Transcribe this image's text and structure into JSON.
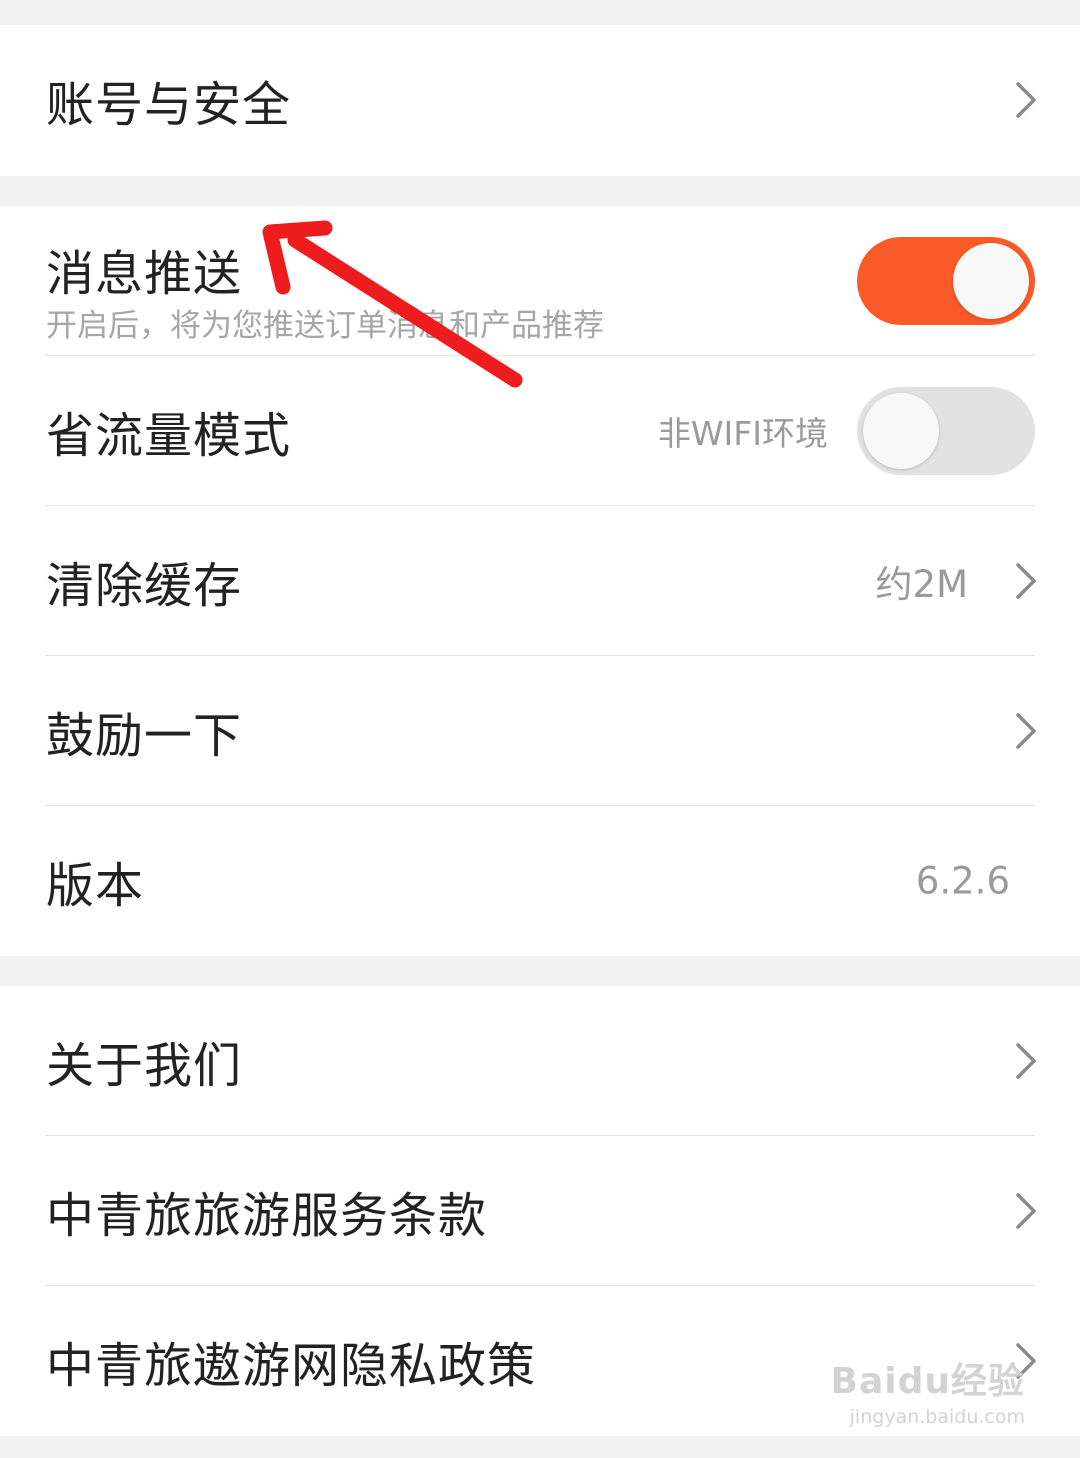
{
  "theme": {
    "accent": "#fa5a28",
    "toggle_off": "#e2e2e2",
    "page_background": "#f2f2f2",
    "annotation_arrow": "#ee1c1c"
  },
  "group_account": {
    "items": [
      {
        "label": "账号与安全",
        "icon": "chevron-right-icon"
      }
    ]
  },
  "group_general": {
    "items": [
      {
        "label": "消息推送",
        "sublabel": "开启后，将为您推送订单消息和产品推荐",
        "control": "toggle",
        "enabled": true
      },
      {
        "label": "省流量模式",
        "value": "非WIFI环境",
        "control": "toggle",
        "enabled": false
      },
      {
        "label": "清除缓存",
        "value": "约2M",
        "icon": "chevron-right-icon"
      },
      {
        "label": "鼓励一下",
        "icon": "chevron-right-icon"
      },
      {
        "label": "版本",
        "value": "6.2.6"
      }
    ]
  },
  "group_about": {
    "items": [
      {
        "label": "关于我们",
        "icon": "chevron-right-icon"
      },
      {
        "label": "中青旅旅游服务条款",
        "icon": "chevron-right-icon"
      },
      {
        "label": "中青旅遨游网隐私政策",
        "icon": "chevron-right-icon"
      }
    ]
  },
  "watermark": {
    "logo": "Baidu经验",
    "url": "jingyan.baidu.com"
  }
}
